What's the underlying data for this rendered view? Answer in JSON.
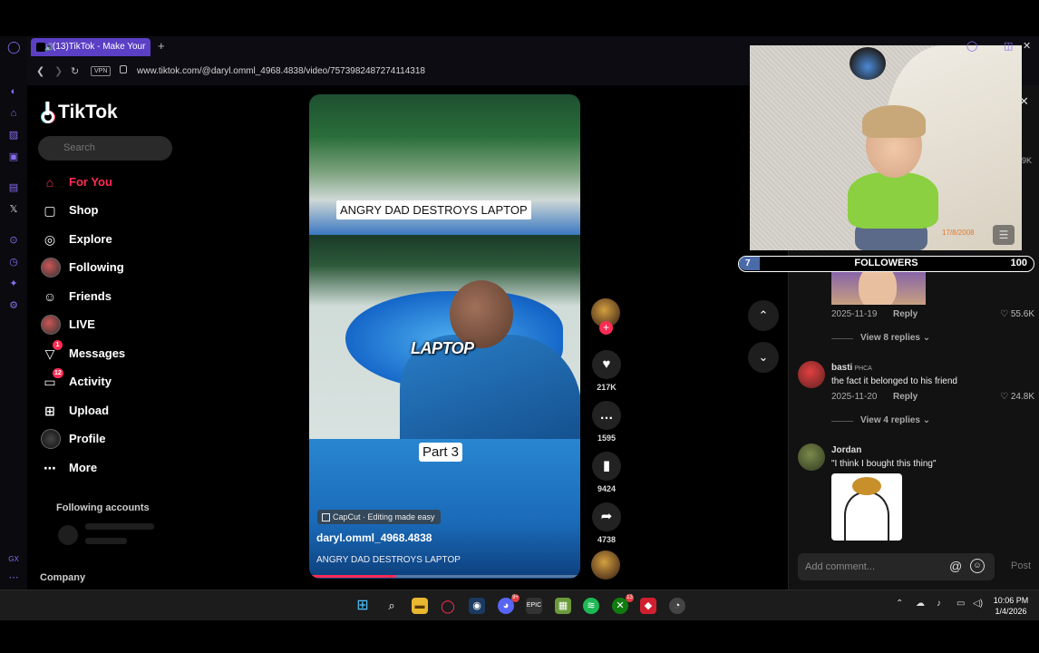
{
  "browser": {
    "tab_title": "(13)TikTok - Make Your",
    "new_tab": "+",
    "vpn_label": "VPN",
    "url": "www.tiktok.com/@daryl.omml_4968.4838/video/7573982487274114318"
  },
  "tiktok": {
    "logo_text": "TikTok",
    "search_placeholder": "Search",
    "nav": [
      {
        "label": "For You",
        "icon": "home-icon"
      },
      {
        "label": "Shop",
        "icon": "shop-bag-icon"
      },
      {
        "label": "Explore",
        "icon": "compass-icon"
      },
      {
        "label": "Following",
        "icon": "avatar"
      },
      {
        "label": "Friends",
        "icon": "friends-icon"
      },
      {
        "label": "LIVE",
        "icon": "avatar"
      },
      {
        "label": "Messages",
        "icon": "send-icon",
        "badge": "1"
      },
      {
        "label": "Activity",
        "icon": "inbox-icon",
        "badge": "12"
      },
      {
        "label": "Upload",
        "icon": "plus-square-icon"
      },
      {
        "label": "Profile",
        "icon": "avatar"
      },
      {
        "label": "More",
        "icon": "more-dots-icon"
      }
    ],
    "following_accounts_header": "Following accounts",
    "company_label": "Company"
  },
  "video": {
    "caption_top": "ANGRY DAD DESTROYS LAPTOP",
    "caption_mid": "LAPTOP",
    "caption_part": "Part 3",
    "capcut_label": "CapCut · Editing made easy",
    "author": "daryl.omml_4968.4838",
    "description": "ANGRY DAD DESTROYS LAPTOP",
    "progress": 0.32
  },
  "actions": {
    "likes": "217K",
    "comments": "1595",
    "saves": "9424",
    "shares": "4738"
  },
  "comments": {
    "items": [
      {
        "date": "2025-11-19",
        "reply": "Reply",
        "likes": "55.6K",
        "view_replies": "View 8 replies"
      },
      {
        "user": "basti",
        "user_tag": "PHCA",
        "text": "the fact it belonged to his friend",
        "date": "2025-11-20",
        "reply": "Reply",
        "likes": "24.8K",
        "view_replies": "View 4 replies"
      },
      {
        "user": "Jordan",
        "text": "\"I think I bought this thing\""
      }
    ],
    "add_placeholder": "Add comment...",
    "at_symbol": "@",
    "post_label": "Post"
  },
  "overlay": {
    "date_stamp": "17/8/2008",
    "side_count": "9K",
    "followers_label": "FOLLOWERS",
    "followers_min": "7",
    "followers_max": "100",
    "followers_fraction": 0.07
  },
  "taskbar": {
    "time": "10:06 PM",
    "date": "1/4/2026",
    "discord_badge": "9+",
    "xbox_badge": "13"
  },
  "colors": {
    "accent": "#fe2c55",
    "opera_purple": "#5b3fc4",
    "background": "#000000"
  }
}
